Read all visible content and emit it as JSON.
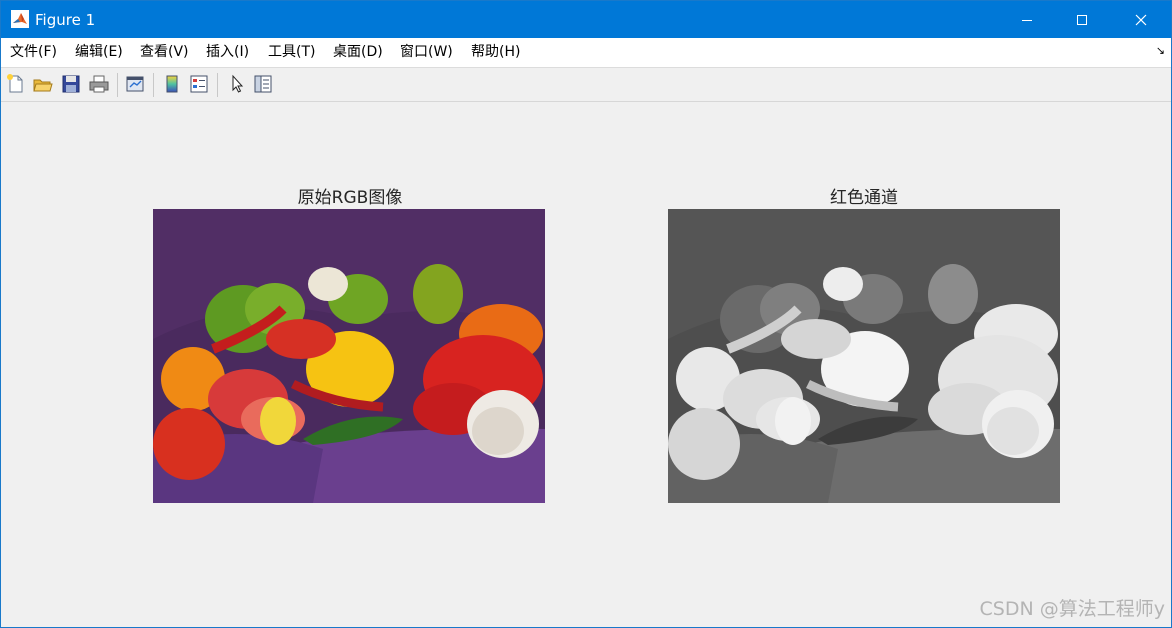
{
  "window": {
    "title": "Figure 1"
  },
  "menubar": {
    "items": [
      "文件(F)",
      "编辑(E)",
      "查看(V)",
      "插入(I)",
      "工具(T)",
      "桌面(D)",
      "窗口(W)",
      "帮助(H)"
    ]
  },
  "toolbar": {
    "buttons": [
      "new-figure-icon",
      "open-file-icon",
      "save-icon",
      "print-icon",
      "link-plot-icon",
      "colorbar-icon",
      "legend-icon",
      "edit-plot-pointer-icon",
      "property-inspector-icon"
    ]
  },
  "figure": {
    "subplots": [
      {
        "title": "原始RGB图像",
        "image": "peppers RGB color"
      },
      {
        "title": "红色通道",
        "image": "peppers red channel grayscale"
      }
    ]
  },
  "watermark": "CSDN @算法工程师y",
  "colors": {
    "titlebar": "#0078d7",
    "figure_bg": "#f0f0f0"
  }
}
